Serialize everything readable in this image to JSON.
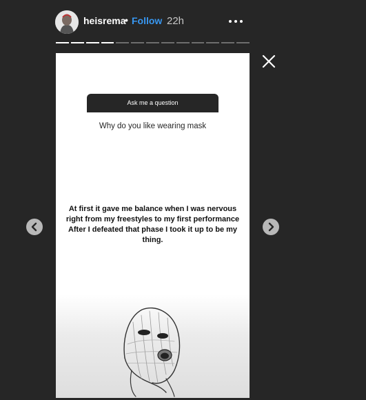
{
  "header": {
    "username": "heisrema",
    "separator": "•",
    "follow_label": "Follow",
    "time_ago": "22h",
    "more_icon": "more-horizontal-icon",
    "avatar_icon": "profile-avatar"
  },
  "progress": {
    "total_segments": 13,
    "completed_segments": 4,
    "active_color": "#ffffff",
    "inactive_color": "#6e6e6e"
  },
  "story": {
    "question_sticker": {
      "header": "Ask me a question",
      "question": "Why do you like wearing mask"
    },
    "answer_lines": [
      "At first it gave me balance when I was nervous",
      "right from my freestyles to my first performance",
      "After I defeated that phase I took it up to be my",
      "thing."
    ],
    "image_icon": "ski-mask-sketch"
  },
  "controls": {
    "close_icon": "close-icon",
    "prev_icon": "chevron-left-icon",
    "next_icon": "chevron-right-icon"
  },
  "colors": {
    "background": "#262626",
    "link": "#3897f0",
    "story_bg": "#ffffff"
  }
}
